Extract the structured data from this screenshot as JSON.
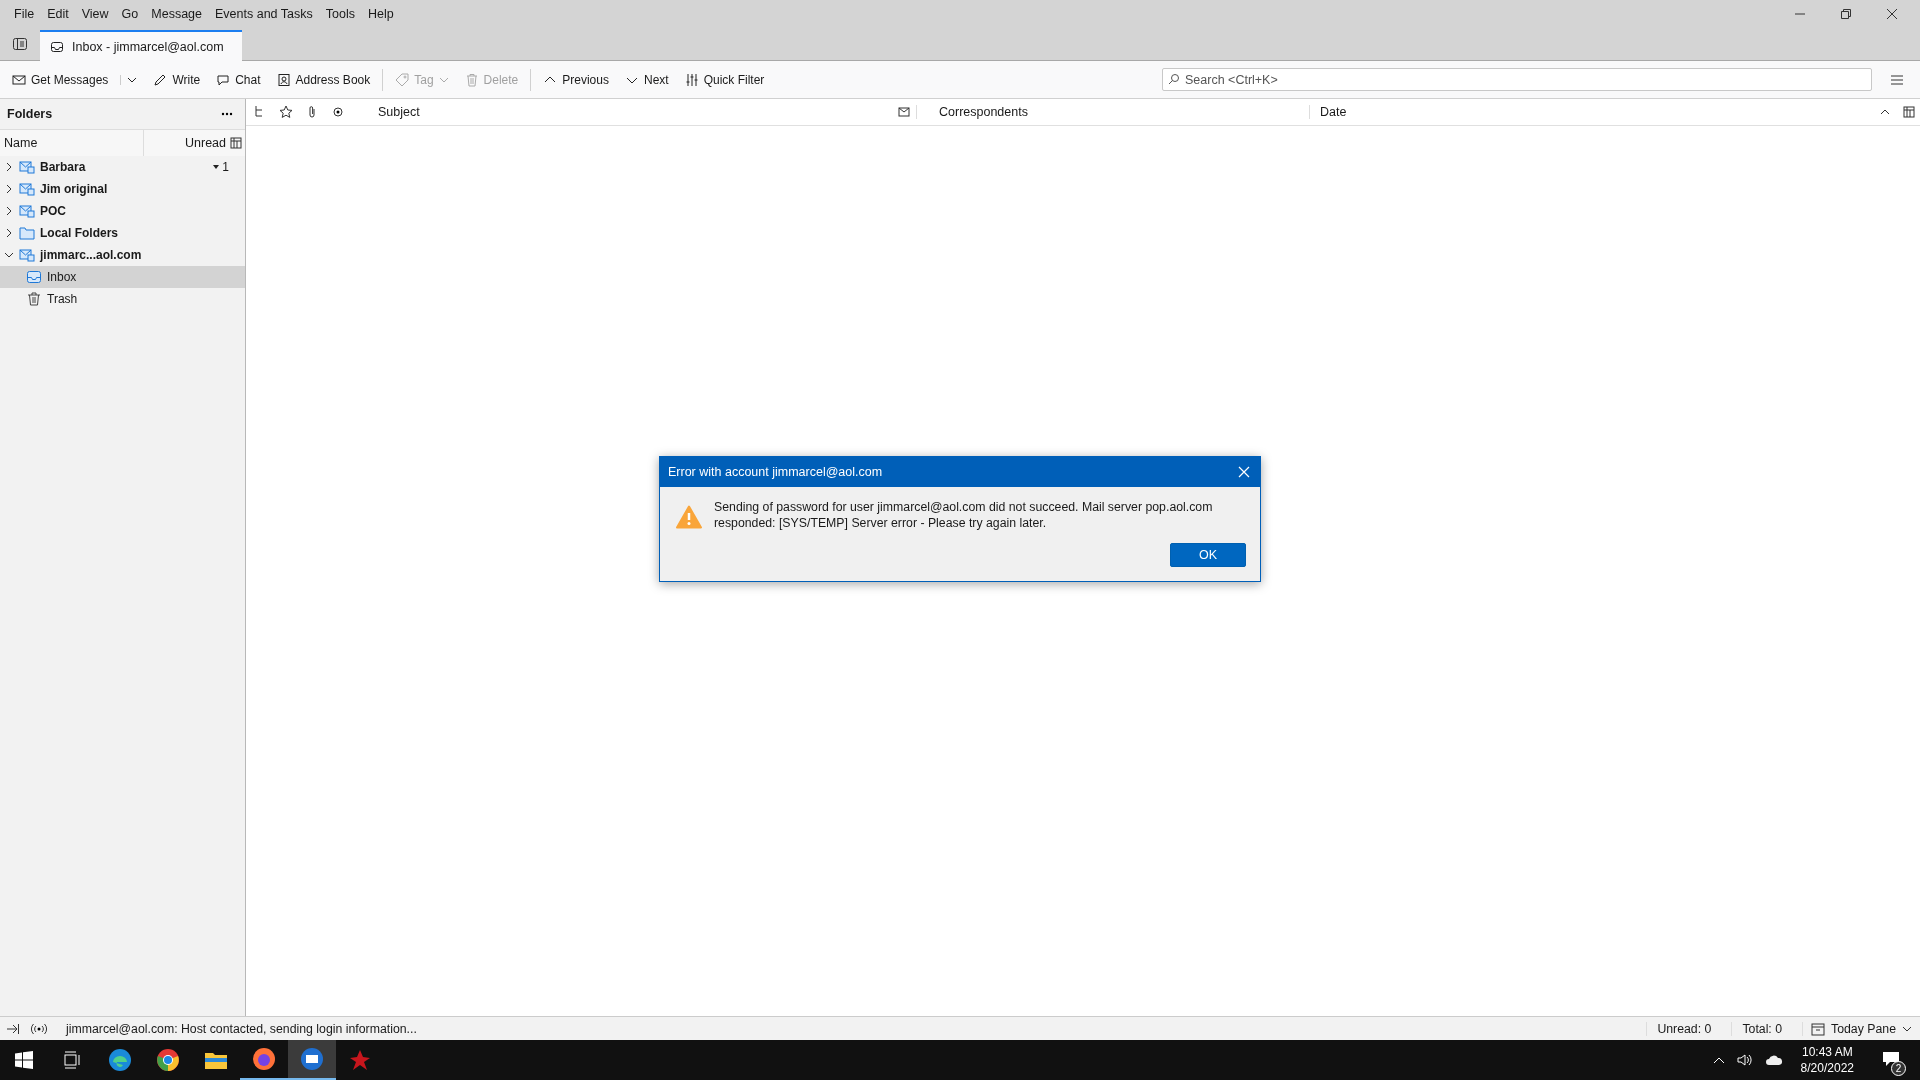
{
  "menu": [
    "File",
    "Edit",
    "View",
    "Go",
    "Message",
    "Events and Tasks",
    "Tools",
    "Help"
  ],
  "tabs": [
    {
      "label": "Inbox - jimmarcel@aol.com",
      "selected": true
    }
  ],
  "toolbar": [
    {
      "kind": "get",
      "label": "Get Messages",
      "disabled": false
    },
    {
      "kind": "write",
      "label": "Write",
      "disabled": false
    },
    {
      "kind": "chat",
      "label": "Chat",
      "disabled": false
    },
    {
      "kind": "address",
      "label": "Address Book",
      "disabled": false
    },
    {
      "kind": "tag",
      "label": "Tag",
      "disabled": true
    },
    {
      "kind": "delete",
      "label": "Delete",
      "disabled": true
    },
    {
      "kind": "previous",
      "label": "Previous",
      "disabled": false
    },
    {
      "kind": "next",
      "label": "Next",
      "disabled": false
    },
    {
      "kind": "filter",
      "label": "Quick Filter",
      "disabled": false
    }
  ],
  "search": {
    "placeholder": "Search <Ctrl+K>"
  },
  "folders": {
    "title": "Folders",
    "columns": [
      "Name",
      "Unread"
    ],
    "tree": [
      {
        "kind": "account",
        "name": "Barbara",
        "expanded": false,
        "selected": false,
        "unread": "1"
      },
      {
        "kind": "account",
        "name": "Jim original",
        "expanded": false,
        "selected": false
      },
      {
        "kind": "account",
        "name": "POC",
        "expanded": false,
        "selected": false
      },
      {
        "kind": "local",
        "name": "Local Folders",
        "expanded": false,
        "selected": false
      },
      {
        "kind": "account",
        "name": "jimmarc...aol.com",
        "expanded": true,
        "selected": false,
        "children": [
          {
            "kind": "inbox",
            "name": "Inbox",
            "selected": true
          },
          {
            "kind": "trash",
            "name": "Trash",
            "selected": false
          }
        ]
      }
    ]
  },
  "message_list": {
    "columns": [
      "Subject",
      "Correspondents",
      "Date"
    ]
  },
  "dialog": {
    "title": "Error with account jimmarcel@aol.com",
    "message": "Sending of password for user jimmarcel@aol.com did not succeed. Mail server pop.aol.com responded: [SYS/TEMP] Server error - Please try again later.",
    "button": "OK"
  },
  "status_bar": {
    "text": "jimmarcel@aol.com: Host contacted, sending login information...",
    "unread": "Unread: 0",
    "total": "Total: 0",
    "today_pane": "Today Pane"
  },
  "taskbar": {
    "apps": [
      {
        "kind": "edge",
        "running": false,
        "selected": false
      },
      {
        "kind": "chrome",
        "running": false,
        "selected": false
      },
      {
        "kind": "explorer",
        "running": false,
        "selected": false
      },
      {
        "kind": "firefox",
        "running": true,
        "selected": false
      },
      {
        "kind": "thunderbird",
        "running": true,
        "selected": true
      },
      {
        "kind": "red",
        "running": false,
        "selected": false
      }
    ],
    "time": "10:43 AM",
    "date": "8/20/2022",
    "notifications": "2"
  }
}
